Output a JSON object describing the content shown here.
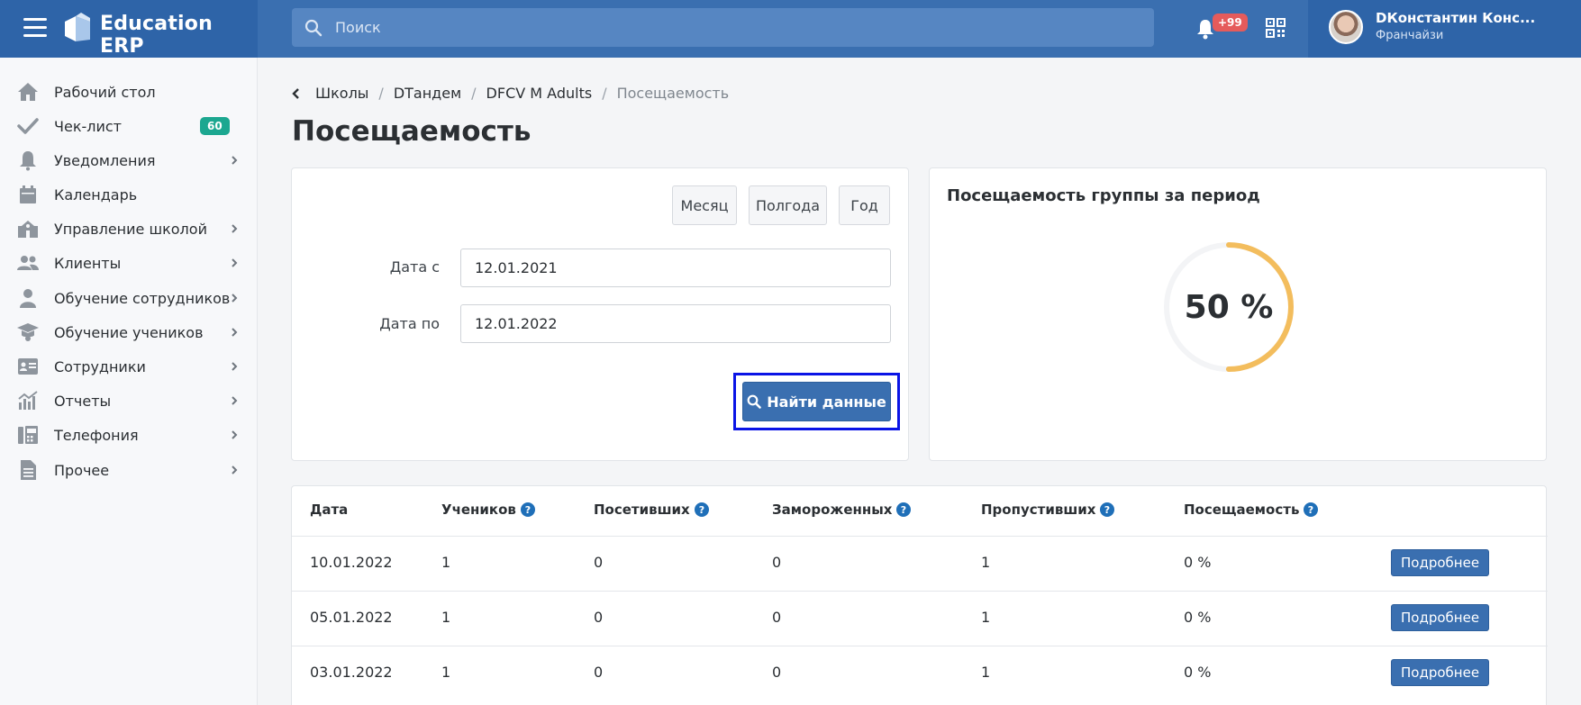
{
  "app": {
    "brand": "Education ERP"
  },
  "header": {
    "search_placeholder": "Поиск",
    "notifications_badge": "+99",
    "user_name": "DКонстантин Конс...",
    "user_role": "Франчайзи"
  },
  "sidebar": {
    "items": [
      {
        "label": "Рабочий стол",
        "icon": "home-icon"
      },
      {
        "label": "Чек-лист",
        "icon": "check-icon",
        "badge": "60"
      },
      {
        "label": "Уведомления",
        "icon": "bell-icon"
      },
      {
        "label": "Календарь",
        "icon": "calendar-icon"
      },
      {
        "label": "Управление школой",
        "icon": "school-icon"
      },
      {
        "label": "Клиенты",
        "icon": "users-icon"
      },
      {
        "label": "Обучение сотрудников",
        "icon": "teacher-icon"
      },
      {
        "label": "Обучение учеников",
        "icon": "graduation-cap-icon"
      },
      {
        "label": "Сотрудники",
        "icon": "id-card-icon"
      },
      {
        "label": "Отчеты",
        "icon": "chart-icon"
      },
      {
        "label": "Телефония",
        "icon": "fax-icon"
      },
      {
        "label": "Прочее",
        "icon": "file-icon"
      }
    ]
  },
  "breadcrumb": {
    "items": [
      "Школы",
      "DТандем",
      "DFCV M Adults"
    ],
    "current": "Посещаемость"
  },
  "page": {
    "title": "Посещаемость"
  },
  "filter": {
    "period_buttons": [
      "Месяц",
      "Полгода",
      "Год"
    ],
    "date_from_label": "Дата с",
    "date_from": "12.01.2021",
    "date_to_label": "Дата по",
    "date_to": "12.01.2022",
    "find_label": "Найти данные"
  },
  "stats": {
    "title": "Посещаемость группы за период",
    "percent_value": 50,
    "percent_text": "50 %",
    "ring_color": "#f3bd5d"
  },
  "table": {
    "headers": [
      "Дата",
      "Учеников",
      "Посетивших",
      "Замороженных",
      "Пропустивших",
      "Посещаемость"
    ],
    "detail_label": "Подробнее",
    "rows": [
      [
        "10.01.2022",
        "1",
        "0",
        "0",
        "1",
        "0 %"
      ],
      [
        "05.01.2022",
        "1",
        "0",
        "0",
        "1",
        "0 %"
      ],
      [
        "03.01.2022",
        "1",
        "0",
        "0",
        "1",
        "0 %"
      ]
    ]
  }
}
